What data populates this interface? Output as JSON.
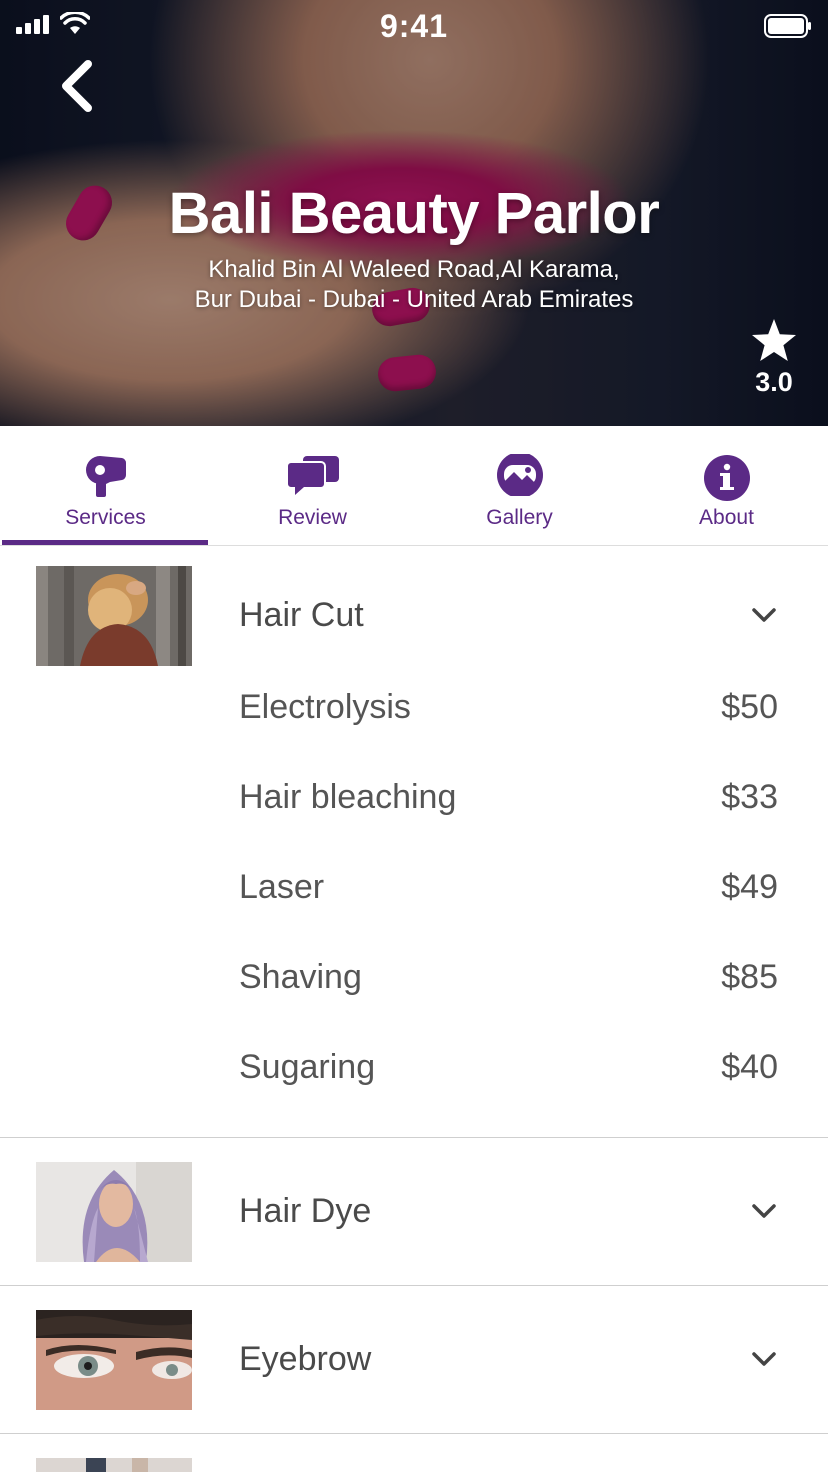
{
  "status_bar": {
    "time": "9:41"
  },
  "hero": {
    "title": "Bali Beauty Parlor",
    "address_line1": "Khalid Bin Al Waleed Road,Al Karama,",
    "address_line2": "Bur Dubai - Dubai - United Arab Emirates",
    "rating": "3.0"
  },
  "tabs": [
    {
      "label": "Services",
      "icon": "hair-dryer-icon",
      "active": true
    },
    {
      "label": "Review",
      "icon": "chat-bubbles-icon",
      "active": false
    },
    {
      "label": "Gallery",
      "icon": "gallery-icon",
      "active": false
    },
    {
      "label": "About",
      "icon": "info-icon",
      "active": false
    }
  ],
  "categories": [
    {
      "name": "Hair Cut",
      "expanded": true,
      "services": [
        {
          "name": "Electrolysis",
          "price": "$50"
        },
        {
          "name": "Hair bleaching",
          "price": "$33"
        },
        {
          "name": "Laser",
          "price": "$49"
        },
        {
          "name": "Shaving",
          "price": "$85"
        },
        {
          "name": "Sugaring",
          "price": "$40"
        }
      ]
    },
    {
      "name": "Hair Dye",
      "expanded": false
    },
    {
      "name": "Eyebrow",
      "expanded": false
    }
  ],
  "colors": {
    "accent": "#5b2a86",
    "text": "#4a4a4a",
    "divider": "#cfcfcf"
  }
}
